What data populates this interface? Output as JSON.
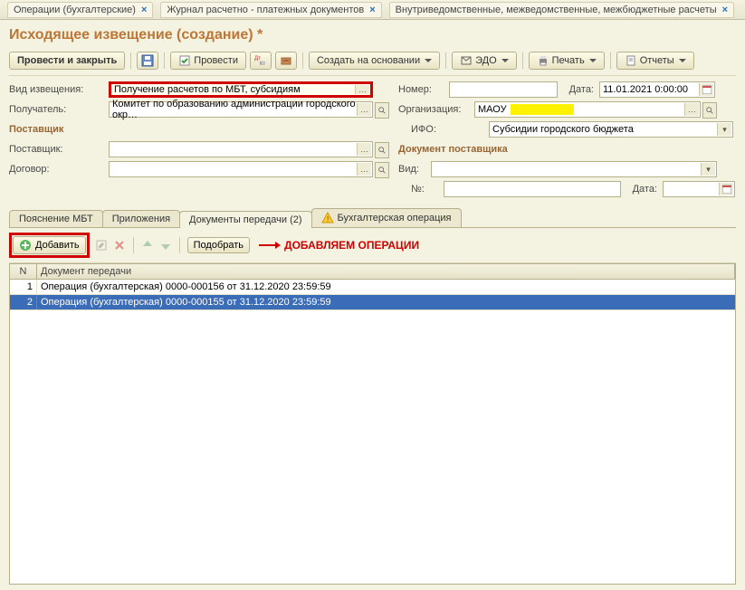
{
  "window_tabs": [
    {
      "label": "Операции (бухгалтерские)"
    },
    {
      "label": "Журнал расчетно - платежных документов"
    },
    {
      "label": "Внутриведомственные, межведомственные, межбюджетные расчеты"
    }
  ],
  "page_title": "Исходящее извещение (создание) *",
  "toolbar": {
    "post_close": "Провести и закрыть",
    "post": "Провести",
    "create_based": "Создать на основании",
    "edo": "ЭДО",
    "print": "Печать",
    "reports": "Отчеты"
  },
  "form": {
    "type_label": "Вид извещения:",
    "type_value": "Получение расчетов по МБТ, субсидиям",
    "number_label": "Номер:",
    "number_value": "",
    "date_label": "Дата:",
    "date_value": "11.01.2021 0:00:00",
    "recipient_label": "Получатель:",
    "recipient_value": "Комитет по образованию администрации городского окр…",
    "org_label": "Организация:",
    "org_value": "МАОУ",
    "ifo_label": "ИФО:",
    "ifo_value": "Субсидии городского бюджета",
    "supplier_heading": "Поставщик",
    "supplier_label": "Поставщик:",
    "supplier_value": "",
    "supplier_doc_heading": "Документ поставщика",
    "contract_label": "Договор:",
    "contract_value": "",
    "kind_label": "Вид:",
    "kind_value": "",
    "no_label": "№:",
    "no_value": "",
    "doc_date_label": "Дата:",
    "doc_date_value": ""
  },
  "tabs": {
    "t1": "Пояснение МБТ",
    "t2": "Приложения",
    "t3": "Документы передачи (2)",
    "t4": "Бухгалтерская операция"
  },
  "subtoolbar": {
    "add": "Добавить",
    "pick": "Подобрать",
    "annotation": "ДОБАВЛЯЕМ ОПЕРАЦИИ"
  },
  "grid": {
    "h_n": "N",
    "h_doc": "Документ передачи",
    "rows": [
      {
        "n": "1",
        "doc": "Операция (бухгалтерская) 0000-000156 от 31.12.2020 23:59:59"
      },
      {
        "n": "2",
        "doc": "Операция (бухгалтерская) 0000-000155 от 31.12.2020 23:59:59"
      }
    ]
  }
}
